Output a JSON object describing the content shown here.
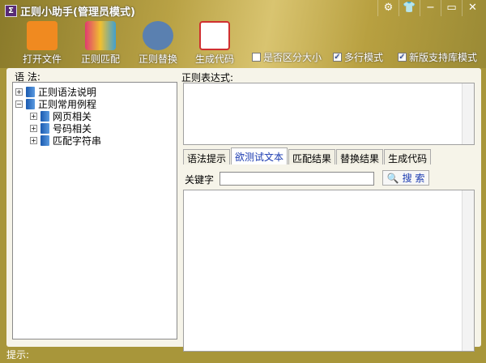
{
  "window": {
    "title": "正则小助手(管理员模式)",
    "app_icon": "Σ"
  },
  "toolbar": {
    "items": [
      {
        "label": "打开文件",
        "icon": "folder-icon",
        "color": "#f08a20"
      },
      {
        "label": "正则匹配",
        "icon": "match-icon",
        "color": "#d04080"
      },
      {
        "label": "正则替换",
        "icon": "binoculars-icon",
        "color": "#5a80b0"
      },
      {
        "label": "生成代码",
        "icon": "code-pen-icon",
        "color": "#d03030"
      }
    ],
    "checkboxes": [
      {
        "label": "是否区分大小",
        "checked": false
      },
      {
        "label": "多行模式",
        "checked": true
      },
      {
        "label": "新版支持库模式",
        "checked": true
      }
    ]
  },
  "left": {
    "label": "语 法:",
    "tree": [
      {
        "label": "正则语法说明",
        "level": 0,
        "expander": "+"
      },
      {
        "label": "正则常用例程",
        "level": 0,
        "expander": "−"
      },
      {
        "label": "网页相关",
        "level": 1,
        "expander": "+"
      },
      {
        "label": "号码相关",
        "level": 1,
        "expander": "+"
      },
      {
        "label": "匹配字符串",
        "level": 1,
        "expander": "+"
      }
    ]
  },
  "right": {
    "regex_label": "正则表达式:",
    "regex_value": "",
    "tabs": [
      "语法提示",
      "欲测试文本",
      "匹配结果",
      "替换结果",
      "生成代码"
    ],
    "active_tab": 1,
    "keyword_label": "关键字",
    "keyword_value": "",
    "search_label": "搜 索"
  },
  "status": {
    "label": "提示:"
  }
}
